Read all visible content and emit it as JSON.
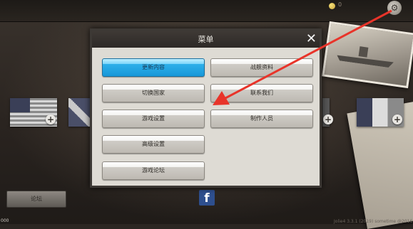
{
  "topbar": {
    "coin_count": "0",
    "gear_glyph": "⚙"
  },
  "menu": {
    "title": "菜单",
    "close_glyph": "✕",
    "buttons": [
      {
        "label": "更新内容",
        "active": true
      },
      {
        "label": "战舰资料",
        "active": false
      },
      {
        "label": "切换国家",
        "active": false
      },
      {
        "label": "联系我们",
        "active": false
      },
      {
        "label": "游戏设置",
        "active": false
      },
      {
        "label": "制作人员",
        "active": false
      },
      {
        "label": "高级设置",
        "active": false
      },
      {
        "label": "游戏论坛",
        "active": false
      }
    ]
  },
  "background": {
    "forum_button": "论坛",
    "facebook_glyph": "f",
    "plus_glyph": "+",
    "version_text": "Jolie4 3.3.1 (2019) sometime @2016",
    "bottom_left": "000"
  },
  "colors": {
    "active_button": "#1797d8",
    "annotation_arrow": "#e8342a",
    "modal_header": "#2d2926"
  },
  "icons": [
    "gear-icon",
    "coin-icon",
    "close-icon",
    "plus-icon",
    "facebook-icon"
  ]
}
